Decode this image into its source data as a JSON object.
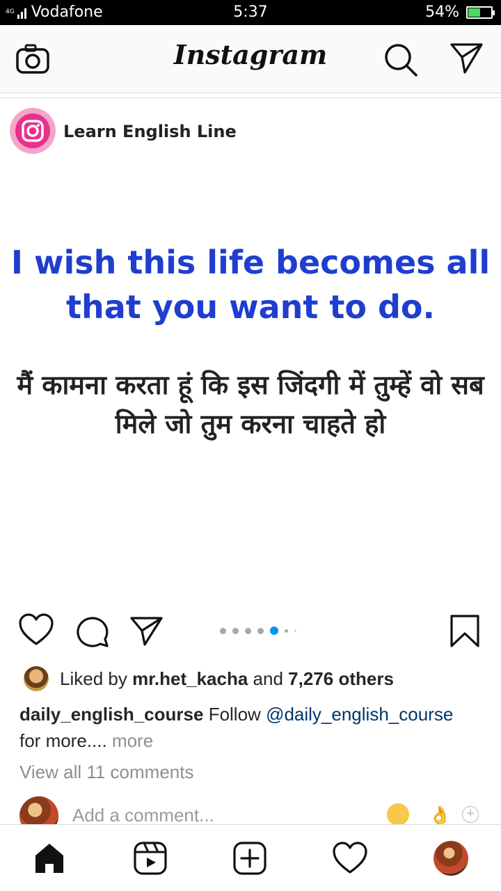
{
  "status_bar": {
    "network": "4G",
    "carrier": "Vodafone",
    "time": "5:37",
    "battery": "54%",
    "battery_level": 0.54
  },
  "header": {
    "logo": "Instagram",
    "icons": [
      "camera-icon",
      "search-icon",
      "direct-message-icon"
    ]
  },
  "post": {
    "account_name": "Learn English Line",
    "text_english": "I wish this life becomes all that you want to do.",
    "text_hindi": "मैं कामना करता हूं कि इस जिंदगी में तुम्हें वो सब मिले जो तुम करना चाहते हो",
    "carousel_active_index": 4,
    "carousel_count": 6
  },
  "engagement": {
    "liked_by_prefix": "Liked by",
    "liked_by_user": "mr.het_kacha",
    "and": "and",
    "others": "7,276 others",
    "caption_user": "daily_english_course",
    "caption_text": "Follow",
    "caption_mention": "@daily_english_course",
    "caption_rest": "for more....",
    "more_label": "more",
    "view_comments": "View all 11 comments",
    "add_comment_placeholder": "Add a comment..."
  },
  "bottom_nav": {
    "items": [
      "home-icon",
      "reels-icon",
      "new-post-icon",
      "activity-icon",
      "profile-avatar"
    ]
  },
  "colors": {
    "accent": "#0095f6",
    "post_english": "#1f3ecf",
    "battery": "#4cd964"
  }
}
